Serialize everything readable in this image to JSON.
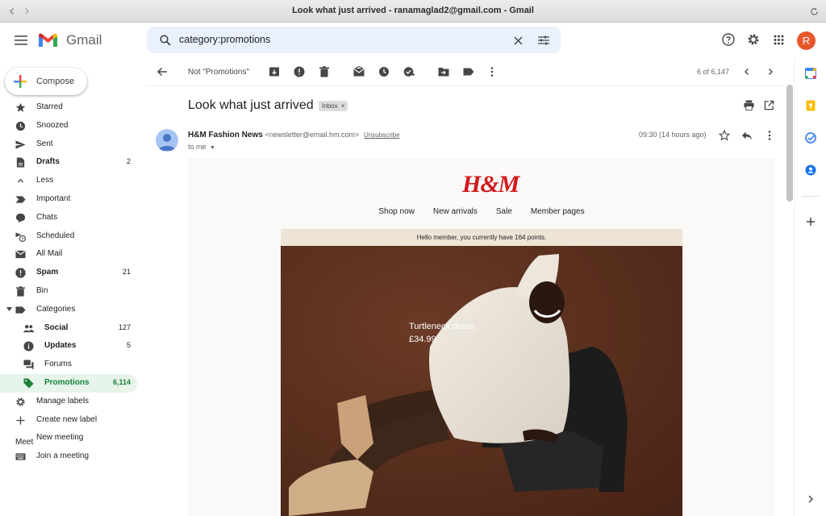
{
  "window": {
    "title": "Look what just arrived - ranamaglad2@gmail.com - Gmail"
  },
  "app": {
    "name": "Gmail",
    "avatar_letter": "R"
  },
  "search": {
    "query": "category:promotions"
  },
  "compose": {
    "label": "Compose"
  },
  "sidebar": {
    "items": [
      {
        "label": "Starred",
        "count": "",
        "icon": "star-icon"
      },
      {
        "label": "Snoozed",
        "count": "",
        "icon": "clock-icon"
      },
      {
        "label": "Sent",
        "count": "",
        "icon": "send-icon"
      },
      {
        "label": "Drafts",
        "count": "2",
        "icon": "draft-icon"
      },
      {
        "label": "Less",
        "count": "",
        "icon": "chevron-up-icon"
      },
      {
        "label": "Important",
        "count": "",
        "icon": "important-icon"
      },
      {
        "label": "Chats",
        "count": "",
        "icon": "chat-icon"
      },
      {
        "label": "Scheduled",
        "count": "",
        "icon": "scheduled-icon"
      },
      {
        "label": "All Mail",
        "count": "",
        "icon": "mail-icon"
      },
      {
        "label": "Spam",
        "count": "21",
        "icon": "spam-icon"
      },
      {
        "label": "Bin",
        "count": "",
        "icon": "trash-icon"
      },
      {
        "label": "Categories",
        "count": "",
        "icon": "label-icon"
      },
      {
        "label": "Social",
        "count": "127",
        "icon": "people-icon"
      },
      {
        "label": "Updates",
        "count": "5",
        "icon": "info-icon"
      },
      {
        "label": "Forums",
        "count": "",
        "icon": "forum-icon"
      },
      {
        "label": "Promotions",
        "count": "6,114",
        "icon": "tag-icon"
      },
      {
        "label": "Manage labels",
        "count": "",
        "icon": "gear-icon"
      },
      {
        "label": "Create new label",
        "count": "",
        "icon": "plus-icon"
      }
    ],
    "meet": {
      "title": "Meet",
      "items": [
        {
          "label": "New meeting",
          "icon": "video-icon"
        },
        {
          "label": "Join a meeting",
          "icon": "keyboard-icon"
        }
      ]
    }
  },
  "toolbar": {
    "filter_label": "Not \"Promotions\"",
    "pager": "6 of 6,147"
  },
  "email": {
    "subject": "Look what just arrived",
    "label_chip": "Inbox",
    "sender_name": "H&M Fashion News",
    "sender_email": "<newsletter@email.hm.com>",
    "unsubscribe": "Unsubscribe",
    "to": "to me",
    "time": "09:30 (14 hours ago)"
  },
  "newsletter": {
    "brand": "H&M",
    "nav": [
      "Shop now",
      "New arrivals",
      "Sale",
      "Member pages"
    ],
    "points_banner": "Hello member, you currently have 164 points.",
    "product_name": "Turtleneck dress",
    "product_price": "£34.99"
  },
  "colors": {
    "accent": "#188038",
    "brand_red": "#d3171b",
    "hero_bg": "#5a2f1f"
  }
}
